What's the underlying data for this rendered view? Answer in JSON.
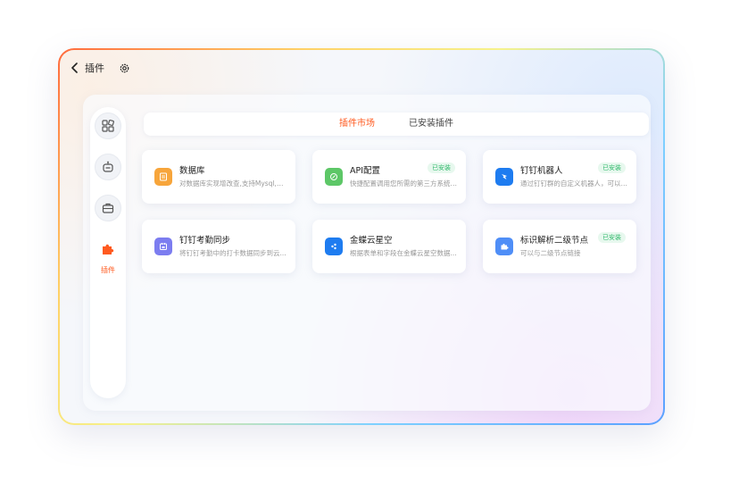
{
  "header": {
    "title": "插件"
  },
  "sidebar": {
    "items": [
      {
        "name": "apps",
        "label": ""
      },
      {
        "name": "robot",
        "label": ""
      },
      {
        "name": "briefcase",
        "label": ""
      },
      {
        "name": "plugin",
        "label": "插件",
        "active": true
      }
    ]
  },
  "tabs": [
    {
      "label": "插件市场",
      "active": true
    },
    {
      "label": "已安装插件",
      "active": false
    }
  ],
  "plugins": [
    {
      "name": "数据库",
      "desc": "对数据库实现增改查,支持Mysql,Or...",
      "installed": false,
      "badge": "",
      "icon": "database-icon",
      "color": "#f7a53b"
    },
    {
      "name": "API配置",
      "desc": "快捷配置调用您所需的第三方系统A...",
      "installed": true,
      "badge": "已安装",
      "icon": "api-icon",
      "color": "#5dc767"
    },
    {
      "name": "钉钉机器人",
      "desc": "通过钉钉群的自定义机器人，可以用...",
      "installed": true,
      "badge": "已安装",
      "icon": "dingtalk-robot-icon",
      "color": "#1e7cf0"
    },
    {
      "name": "钉钉考勤同步",
      "desc": "将钉钉考勤中的打卡数据同步到云...",
      "installed": false,
      "badge": "",
      "icon": "attendance-icon",
      "color": "#7c7df0"
    },
    {
      "name": "金蝶云星空",
      "desc": "根据表单和字段在金蝶云星空数据...",
      "installed": false,
      "badge": "",
      "icon": "kingdee-icon",
      "color": "#1e7cf0"
    },
    {
      "name": "标识解析二级节点",
      "desc": "可以与二级节点链接",
      "installed": true,
      "badge": "已安装",
      "icon": "puzzle-icon",
      "color": "#4f8ef7"
    }
  ],
  "colors": {
    "accent": "#ff5a1f",
    "installed_text": "#2fb86a",
    "installed_bg": "#e7f8ee"
  }
}
